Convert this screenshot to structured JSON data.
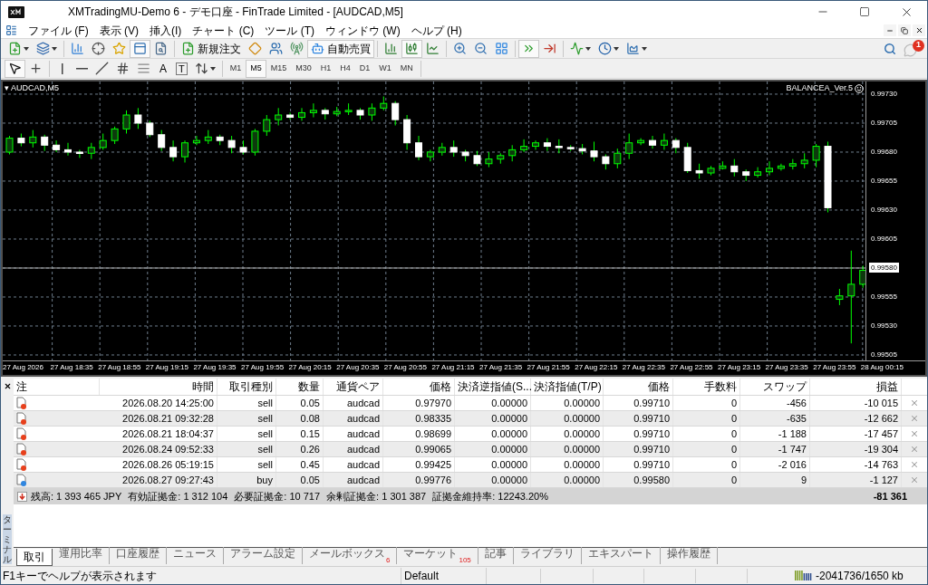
{
  "window": {
    "title": "XMTradingMU-Demo 6 - デモ口座 - FinTrade Limited - [AUDCAD,M5]"
  },
  "menu": [
    "ファイル (F)",
    "表示 (V)",
    "挿入(I)",
    "チャート (C)",
    "ツール (T)",
    "ウィンドウ (W)",
    "ヘルプ (H)"
  ],
  "toolbar": [
    {
      "kind": "newchart",
      "pressed": false,
      "dropdown": true
    },
    {
      "kind": "profiles",
      "pressed": false,
      "dropdown": true
    },
    {
      "kind": "separator"
    },
    {
      "kind": "marketwatch",
      "pressed": false
    },
    {
      "kind": "navigator",
      "pressed": false
    },
    {
      "kind": "favorites",
      "pressed": false
    },
    {
      "kind": "terminal",
      "pressed": true
    },
    {
      "kind": "tester",
      "pressed": false
    },
    {
      "kind": "separator"
    },
    {
      "kind": "neworder",
      "pressed": false,
      "label": "新規注文"
    },
    {
      "kind": "editor",
      "pressed": false
    },
    {
      "kind": "signals",
      "pressed": false
    },
    {
      "kind": "broadcast",
      "pressed": false
    },
    {
      "kind": "autotrading",
      "pressed": true,
      "label": "自動売買"
    },
    {
      "kind": "separator"
    },
    {
      "kind": "barchart",
      "pressed": false
    },
    {
      "kind": "candles",
      "pressed": true
    },
    {
      "kind": "linechart",
      "pressed": false
    },
    {
      "kind": "separator"
    },
    {
      "kind": "zoomin",
      "pressed": false
    },
    {
      "kind": "zoomout",
      "pressed": false
    },
    {
      "kind": "tile",
      "pressed": false
    },
    {
      "kind": "separator"
    },
    {
      "kind": "autoscroll",
      "pressed": true
    },
    {
      "kind": "shift",
      "pressed": false
    },
    {
      "kind": "separator"
    },
    {
      "kind": "indicators",
      "pressed": false,
      "dropdown": true
    },
    {
      "kind": "periods",
      "pressed": false,
      "dropdown": true
    },
    {
      "kind": "templates",
      "pressed": false,
      "dropdown": true
    }
  ],
  "notifications": {
    "badge": "1"
  },
  "drawing_tools": [
    {
      "kind": "cursor",
      "pressed": true
    },
    {
      "kind": "crosshair",
      "pressed": false
    },
    {
      "kind": "separator"
    },
    {
      "kind": "vline",
      "pressed": false
    },
    {
      "kind": "hline",
      "pressed": false
    },
    {
      "kind": "trendline",
      "pressed": false
    },
    {
      "kind": "channel",
      "pressed": false
    },
    {
      "kind": "fibo",
      "pressed": false
    },
    {
      "kind": "text",
      "pressed": false,
      "label": "A"
    },
    {
      "kind": "textlabel",
      "pressed": false,
      "label": "T"
    },
    {
      "kind": "arrows",
      "pressed": false,
      "dropdown": true
    }
  ],
  "timeframes": [
    {
      "label": "M1",
      "selected": false
    },
    {
      "label": "M5",
      "selected": true
    },
    {
      "label": "M15",
      "selected": false
    },
    {
      "label": "M30",
      "selected": false
    },
    {
      "label": "H1",
      "selected": false
    },
    {
      "label": "H4",
      "selected": false
    },
    {
      "label": "D1",
      "selected": false
    },
    {
      "label": "W1",
      "selected": false
    },
    {
      "label": "MN",
      "selected": false
    }
  ],
  "chart": {
    "symbol": "▾ AUDCAD,M5",
    "expert": "BALANCEA_Ver.5",
    "time_labels": [
      "27 Aug 2026",
      "27 Aug 18:35",
      "27 Aug 18:55",
      "27 Aug 19:15",
      "27 Aug 19:35",
      "27 Aug 19:55",
      "27 Aug 20:15",
      "27 Aug 20:35",
      "27 Aug 20:55",
      "27 Aug 21:15",
      "27 Aug 21:35",
      "27 Aug 21:55",
      "27 Aug 22:15",
      "27 Aug 22:35",
      "27 Aug 22:55",
      "27 Aug 23:15",
      "27 Aug 23:35",
      "27 Aug 23:55",
      "28 Aug 00:15"
    ],
    "chart_data": {
      "type": "candlestick",
      "ylim": [
        0.995003,
        0.997409
      ],
      "yticks": [
        {
          "value": 0.9973,
          "label": "0.99730"
        },
        {
          "value": 0.99705,
          "label": "0.99705"
        },
        {
          "value": 0.9968,
          "label": "0.99680"
        },
        {
          "value": 0.99655,
          "label": "0.99655"
        },
        {
          "value": 0.9963,
          "label": "0.99630"
        },
        {
          "value": 0.99605,
          "label": "0.99605"
        },
        {
          "value": 0.9958,
          "label": "0.99580"
        },
        {
          "value": 0.99555,
          "label": "0.99555"
        },
        {
          "value": 0.9953,
          "label": "0.99530"
        },
        {
          "value": 0.99505,
          "label": "0.99505"
        }
      ],
      "ref_lines": [
        {
          "axis": "y",
          "value": 0.9958
        }
      ],
      "grid": true,
      "categories": [
        null,
        null,
        null,
        null,
        null,
        null,
        null,
        null,
        null,
        null,
        null,
        null,
        null,
        null,
        null,
        null,
        null,
        null,
        null,
        null,
        null,
        null,
        null,
        null,
        null,
        null,
        null,
        null,
        null,
        null,
        null,
        null,
        null,
        null,
        null,
        null,
        null,
        null,
        null,
        null,
        null,
        null,
        null,
        null,
        null,
        null,
        null,
        null,
        null,
        null,
        null,
        null,
        null,
        null,
        null,
        null,
        null,
        null,
        null,
        null,
        null,
        null,
        null,
        null,
        null,
        null,
        null,
        null,
        null,
        null,
        null,
        null,
        null,
        null
      ],
      "ohlc": [
        [
          0.9968,
          0.99694,
          0.99678,
          0.99692
        ],
        [
          0.99692,
          0.99696,
          0.99685,
          0.99688
        ],
        [
          0.99688,
          0.99699,
          0.99684,
          0.99693
        ],
        [
          0.99693,
          0.99695,
          0.99681,
          0.99686
        ],
        [
          0.99686,
          0.9969,
          0.9968,
          0.99682
        ],
        [
          0.99682,
          0.99688,
          0.99677,
          0.9968
        ],
        [
          0.9968,
          0.99682,
          0.99675,
          0.99679
        ],
        [
          0.99679,
          0.99688,
          0.99674,
          0.99684
        ],
        [
          0.99684,
          0.99696,
          0.99682,
          0.9969
        ],
        [
          0.9969,
          0.99702,
          0.99687,
          0.997
        ],
        [
          0.997,
          0.99716,
          0.99696,
          0.99712
        ],
        [
          0.99712,
          0.99718,
          0.997,
          0.99705
        ],
        [
          0.99705,
          0.99707,
          0.99693,
          0.99695
        ],
        [
          0.99695,
          0.99699,
          0.99681,
          0.99684
        ],
        [
          0.99684,
          0.9969,
          0.99672,
          0.99676
        ],
        [
          0.99676,
          0.9969,
          0.99671,
          0.99688
        ],
        [
          0.99688,
          0.99694,
          0.99686,
          0.9969
        ],
        [
          0.9969,
          0.99699,
          0.99687,
          0.99693
        ],
        [
          0.99693,
          0.99695,
          0.99686,
          0.9969
        ],
        [
          0.9969,
          0.99694,
          0.99679,
          0.99684
        ],
        [
          0.99684,
          0.9969,
          0.99678,
          0.9968
        ],
        [
          0.9968,
          0.997,
          0.99677,
          0.99698
        ],
        [
          0.99698,
          0.99712,
          0.99694,
          0.99708
        ],
        [
          0.99708,
          0.99718,
          0.99703,
          0.99712
        ],
        [
          0.99712,
          0.99714,
          0.99708,
          0.9971
        ],
        [
          0.9971,
          0.99718,
          0.99707,
          0.99714
        ],
        [
          0.99714,
          0.99722,
          0.9971,
          0.99716
        ],
        [
          0.99716,
          0.99718,
          0.99708,
          0.99713
        ],
        [
          0.99713,
          0.99719,
          0.99711,
          0.99715
        ],
        [
          0.99715,
          0.99722,
          0.99712,
          0.99716
        ],
        [
          0.99716,
          0.99718,
          0.99708,
          0.99712
        ],
        [
          0.99712,
          0.99722,
          0.99707,
          0.99718
        ],
        [
          0.99718,
          0.99728,
          0.99716,
          0.99722
        ],
        [
          0.99722,
          0.99724,
          0.99703,
          0.99708
        ],
        [
          0.99708,
          0.99712,
          0.99682,
          0.99688
        ],
        [
          0.99688,
          0.99694,
          0.99673,
          0.99676
        ],
        [
          0.99676,
          0.99682,
          0.99672,
          0.9968
        ],
        [
          0.9968,
          0.99688,
          0.99677,
          0.99684
        ],
        [
          0.99684,
          0.9969,
          0.99676,
          0.9968
        ],
        [
          0.9968,
          0.99682,
          0.99672,
          0.99677
        ],
        [
          0.99677,
          0.99681,
          0.99668,
          0.9967
        ],
        [
          0.9967,
          0.9968,
          0.99667,
          0.99674
        ],
        [
          0.99674,
          0.99679,
          0.9967,
          0.99677
        ],
        [
          0.99677,
          0.99686,
          0.99672,
          0.99682
        ],
        [
          0.99682,
          0.99691,
          0.9968,
          0.99685
        ],
        [
          0.99685,
          0.9969,
          0.99682,
          0.99688
        ],
        [
          0.99688,
          0.99692,
          0.99681,
          0.99685
        ],
        [
          0.99685,
          0.99691,
          0.99679,
          0.99684
        ],
        [
          0.99684,
          0.99686,
          0.99681,
          0.99683
        ],
        [
          0.99683,
          0.99687,
          0.99678,
          0.99681
        ],
        [
          0.99681,
          0.99689,
          0.99672,
          0.99676
        ],
        [
          0.99676,
          0.99678,
          0.99665,
          0.9967
        ],
        [
          0.9967,
          0.99683,
          0.99666,
          0.99679
        ],
        [
          0.99679,
          0.99696,
          0.99674,
          0.99688
        ],
        [
          0.99688,
          0.99692,
          0.99686,
          0.9969
        ],
        [
          0.9969,
          0.99694,
          0.99683,
          0.99686
        ],
        [
          0.99686,
          0.99696,
          0.99682,
          0.9969
        ],
        [
          0.9969,
          0.99692,
          0.99679,
          0.99684
        ],
        [
          0.99684,
          0.99688,
          0.99662,
          0.99664
        ],
        [
          0.99664,
          0.9967,
          0.99657,
          0.99662
        ],
        [
          0.99662,
          0.99668,
          0.9966,
          0.99666
        ],
        [
          0.99666,
          0.99672,
          0.99665,
          0.99668
        ],
        [
          0.99668,
          0.99674,
          0.99659,
          0.99663
        ],
        [
          0.99663,
          0.99665,
          0.99655,
          0.9966
        ],
        [
          0.9966,
          0.99667,
          0.99658,
          0.99663
        ],
        [
          0.99663,
          0.99672,
          0.9966,
          0.99666
        ],
        [
          0.99666,
          0.9967,
          0.99664,
          0.99668
        ],
        [
          0.99668,
          0.99674,
          0.99665,
          0.9967
        ],
        [
          0.9967,
          0.99679,
          0.99666,
          0.99673
        ],
        [
          0.99673,
          0.99687,
          0.99667,
          0.99685
        ],
        [
          0.99685,
          0.99689,
          0.99628,
          0.99632
        ],
        [
          0.99553,
          0.99562,
          0.99548,
          0.99556
        ],
        [
          0.99556,
          0.99595,
          0.99515,
          0.99566
        ],
        [
          0.99566,
          0.99582,
          0.99563,
          0.99578
        ]
      ]
    }
  },
  "terminal": {
    "title": "ターミナル",
    "icon_column": "注",
    "columns": [
      "時間",
      "取引種別",
      "数量",
      "通貨ペア",
      "価格",
      "決済逆指値(S...",
      "決済指値(T/P)",
      "価格",
      "手数料",
      "スワップ",
      "損益"
    ],
    "rows": [
      {
        "color": "#e8401c",
        "cells": [
          "2026.08.20 14:25:00",
          "sell",
          "0.05",
          "audcad",
          "0.97970",
          "0.00000",
          "0.00000",
          "0.99710",
          "0",
          "-456",
          "-10 015"
        ]
      },
      {
        "color": "#e8401c",
        "cells": [
          "2026.08.21 09:32:28",
          "sell",
          "0.08",
          "audcad",
          "0.98335",
          "0.00000",
          "0.00000",
          "0.99710",
          "0",
          "-635",
          "-12 662"
        ]
      },
      {
        "color": "#e8401c",
        "cells": [
          "2026.08.21 18:04:37",
          "sell",
          "0.15",
          "audcad",
          "0.98699",
          "0.00000",
          "0.00000",
          "0.99710",
          "0",
          "-1 188",
          "-17 457"
        ]
      },
      {
        "color": "#e8401c",
        "cells": [
          "2026.08.24 09:52:33",
          "sell",
          "0.26",
          "audcad",
          "0.99065",
          "0.00000",
          "0.00000",
          "0.99710",
          "0",
          "-1 747",
          "-19 304"
        ]
      },
      {
        "color": "#e8401c",
        "cells": [
          "2026.08.26 05:19:15",
          "sell",
          "0.45",
          "audcad",
          "0.99425",
          "0.00000",
          "0.00000",
          "0.99710",
          "0",
          "-2 016",
          "-14 763"
        ]
      },
      {
        "color": "#2f86e0",
        "cells": [
          "2026.08.27 09:27:43",
          "buy",
          "0.05",
          "audcad",
          "0.99776",
          "0.00000",
          "0.00000",
          "0.99580",
          "0",
          "9",
          "-1 127"
        ]
      }
    ],
    "summary": {
      "texts": [
        "残高: 1 393 465 JPY",
        "有効証拠金: 1 312 104",
        "必要証拠金: 10 717",
        "余剰証拠金: 1 301 387",
        "証拠金維持率: 12243.20%"
      ],
      "total": "-81 361"
    },
    "tabs": [
      {
        "label": "取引",
        "selected": true
      },
      {
        "label": "運用比率",
        "selected": false
      },
      {
        "label": "口座履歴",
        "selected": false
      },
      {
        "label": "ニュース",
        "selected": false
      },
      {
        "label": "アラーム設定",
        "selected": false
      },
      {
        "label": "メールボックス",
        "selected": false,
        "badge": "6"
      },
      {
        "label": "マーケット",
        "selected": false,
        "badge": "105"
      },
      {
        "label": "記事",
        "selected": false
      },
      {
        "label": "ライブラリ",
        "selected": false
      },
      {
        "label": "エキスパート",
        "selected": false
      },
      {
        "label": "操作履歴",
        "selected": false
      }
    ]
  },
  "status_bar": {
    "help": "F1キーでヘルプが表示されます",
    "profile": "Default",
    "traffic": "-2041736/1650 kb"
  }
}
